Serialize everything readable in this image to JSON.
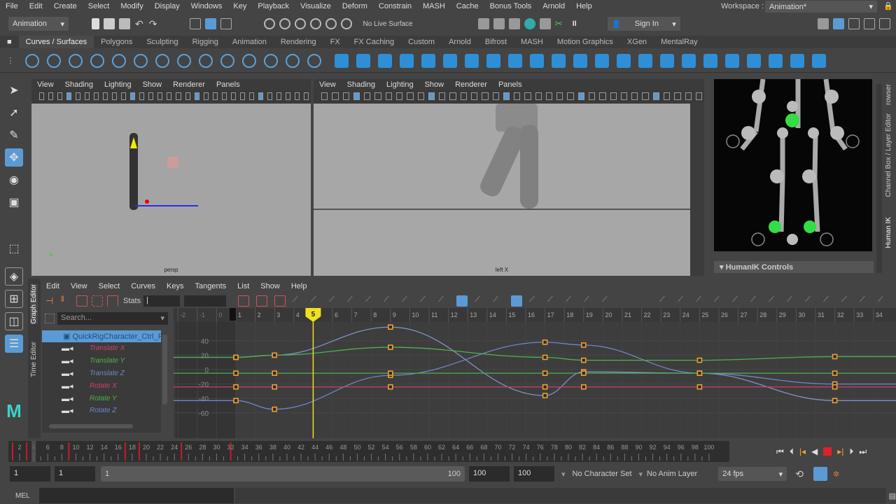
{
  "menubar": {
    "items": [
      "File",
      "Edit",
      "Create",
      "Select",
      "Modify",
      "Display",
      "Windows",
      "Key",
      "Playback",
      "Visualize",
      "Deform",
      "Constrain",
      "MASH",
      "Cache",
      "Bonus Tools",
      "Arnold",
      "Help"
    ],
    "workspace_label": "Workspace :",
    "workspace_value": "Animation*"
  },
  "statusline": {
    "mode": "Animation",
    "live_surface": "No Live Surface",
    "sign_in": "Sign In"
  },
  "shelf": {
    "tabs": [
      "Curves / Surfaces",
      "Polygons",
      "Sculpting",
      "Rigging",
      "Animation",
      "Rendering",
      "FX",
      "FX Caching",
      "Custom",
      "Arnold",
      "Bifrost",
      "MASH",
      "Motion Graphics",
      "XGen",
      "MentalRay"
    ],
    "active": "Curves / Surfaces"
  },
  "viewports": [
    {
      "menu": [
        "View",
        "Shading",
        "Lighting",
        "Show",
        "Renderer",
        "Panels"
      ],
      "camera": "persp"
    },
    {
      "menu": [
        "View",
        "Shading",
        "Lighting",
        "Show",
        "Renderer",
        "Panels"
      ],
      "camera": "left X"
    }
  ],
  "right_panel": {
    "tabs": [
      "rowser",
      "Channel Box / Layer Editor",
      "Human IK"
    ],
    "section": "HumanIK Controls"
  },
  "graph_editor": {
    "side_tabs": [
      "Graph Editor",
      "Time Editor"
    ],
    "menu": [
      "Edit",
      "View",
      "Select",
      "Curves",
      "Keys",
      "Tangents",
      "List",
      "Show",
      "Help"
    ],
    "stats_label": "Stats",
    "stats_value": "|",
    "search_placeholder": "Search...",
    "outliner": {
      "node": "QuickRigCharacter_Ctrl_R",
      "channels": [
        {
          "name": "Translate X",
          "color": "#d0406a"
        },
        {
          "name": "Translate Y",
          "color": "#4fb050"
        },
        {
          "name": "Translate Z",
          "color": "#6f86c8"
        },
        {
          "name": "Rotate X",
          "color": "#d0406a"
        },
        {
          "name": "Rotate Y",
          "color": "#4fb050"
        },
        {
          "name": "Rotate Z",
          "color": "#6f86c8"
        }
      ]
    },
    "current_frame": "5",
    "ruler_frames": [
      -2,
      -1,
      0,
      1,
      2,
      3,
      4,
      5,
      6,
      7,
      8,
      9,
      10,
      11,
      12,
      13,
      14,
      15,
      16,
      17,
      18,
      19,
      20,
      21,
      22,
      23,
      24,
      25,
      26,
      27,
      28,
      29,
      30,
      31,
      32,
      33,
      34
    ],
    "value_ticks": [
      40,
      20,
      0,
      -20,
      -40,
      -60
    ],
    "curves": [
      {
        "channel": "Translate Z",
        "color": "#7f93c8",
        "keys": [
          [
            1,
            17
          ],
          [
            3,
            20
          ],
          [
            9,
            59
          ],
          [
            17,
            -36
          ],
          [
            19,
            -3
          ],
          [
            25,
            -5
          ],
          [
            32,
            -43
          ]
        ]
      },
      {
        "channel": "Rotate Z",
        "color": "#6f86c8",
        "keys": [
          [
            1,
            -43
          ],
          [
            3,
            -55
          ],
          [
            9,
            -8
          ],
          [
            17,
            38
          ],
          [
            19,
            34
          ],
          [
            25,
            -5
          ],
          [
            32,
            -20
          ]
        ]
      },
      {
        "channel": "Translate Y",
        "color": "#4fb050",
        "keys": [
          [
            1,
            17
          ],
          [
            3,
            20
          ],
          [
            9,
            31
          ],
          [
            17,
            17
          ],
          [
            19,
            13
          ],
          [
            25,
            13
          ],
          [
            32,
            18
          ]
        ]
      },
      {
        "channel": "Rotate Y",
        "color": "#4fb050",
        "keys": [
          [
            1,
            -5
          ],
          [
            3,
            -5
          ],
          [
            9,
            -5
          ],
          [
            17,
            -5
          ],
          [
            19,
            -5
          ],
          [
            25,
            -5
          ],
          [
            32,
            -5
          ]
        ]
      },
      {
        "channel": "Rotate X",
        "color": "#d0406a",
        "keys": [
          [
            1,
            -24
          ],
          [
            3,
            -24
          ],
          [
            9,
            -24
          ],
          [
            17,
            -24
          ],
          [
            19,
            -24
          ],
          [
            25,
            -24
          ],
          [
            32,
            -24
          ]
        ]
      }
    ]
  },
  "timeslider": {
    "start": 1,
    "end": 100,
    "current": 4,
    "key_frames": [
      1,
      3,
      9,
      17,
      19,
      25,
      32
    ]
  },
  "range": {
    "start_outer": "1",
    "start_inner": "1",
    "slider_start": "1",
    "slider_end": "100",
    "end_inner": "100",
    "end_outer": "100",
    "character_set": "No Character Set",
    "anim_layer": "No Anim Layer",
    "fps": "24 fps"
  },
  "command_line": {
    "label": "MEL"
  },
  "colors": {
    "accent": "#5b9bd5",
    "current_time": "#f0e020",
    "key": "#f0a030"
  }
}
